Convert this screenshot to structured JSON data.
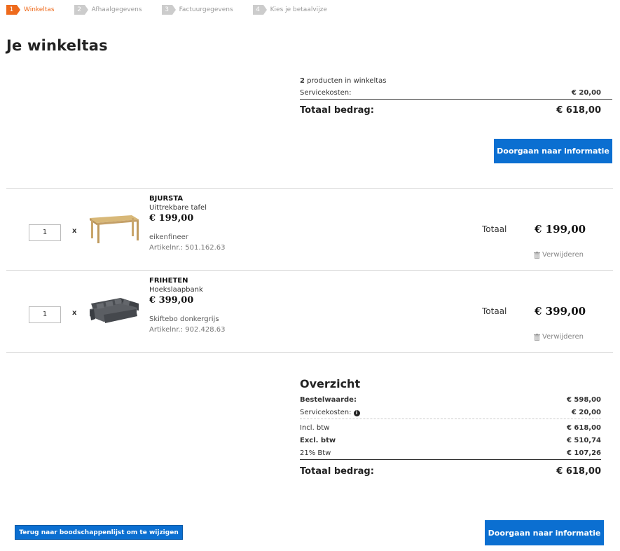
{
  "steps": [
    {
      "num": "1",
      "label": "Winkeltas",
      "active": true
    },
    {
      "num": "2",
      "label": "Afhaalgegevens",
      "active": false
    },
    {
      "num": "3",
      "label": "Factuurgegevens",
      "active": false
    },
    {
      "num": "4",
      "label": "Kies je betaalvijze",
      "active": false
    }
  ],
  "page_title": "Je winkeltas",
  "summary": {
    "count": "2",
    "count_suffix": " producten in winkeltas",
    "service_label": "Servicekosten:",
    "service_value": "€ 20,00",
    "total_label": "Totaal bedrag:",
    "total_value": "€ 618,00",
    "continue_label": "Doorgaan naar informatie"
  },
  "items": [
    {
      "qty": "1",
      "times": "x",
      "image_icon": "dining-table-icon",
      "name": "BJURSTA",
      "desc": "Uittrekbare tafel",
      "price": "€ 199,00",
      "color": "eikenfineer",
      "article": "Artikelnr.: 501.162.63",
      "total_label": "Totaal",
      "total_value": "€  199,00",
      "remove_label": "Verwijderen"
    },
    {
      "qty": "1",
      "times": "x",
      "image_icon": "corner-sofa-bed-icon",
      "name": "FRIHETEN",
      "desc": "Hoekslaapbank",
      "price": "€ 399,00",
      "color": "Skiftebo donkergrijs",
      "article": "Artikelnr.: 902.428.63",
      "total_label": "Totaal",
      "total_value": "€  399,00",
      "remove_label": "Verwijderen"
    }
  ],
  "overview": {
    "title": "Overzicht",
    "order_label": "Bestelwaarde:",
    "order_value": "€ 598,00",
    "service_label": "Servicekosten:",
    "service_value": "€ 20,00",
    "incl_label": "Incl. btw",
    "incl_value": "€ 618,00",
    "excl_label": "Excl. btw",
    "excl_value": "€ 510,74",
    "vat_label": "21% Btw",
    "vat_value": "€ 107,26",
    "total_label": "Totaal bedrag:",
    "total_value": "€ 618,00"
  },
  "buttons": {
    "back_label": "Terug naar boodschappenlijst om te wijzigen",
    "continue_label": "Doorgaan naar informatie"
  },
  "colors": {
    "accent": "#ee6a1c",
    "primary_button": "#0b6fd1"
  }
}
